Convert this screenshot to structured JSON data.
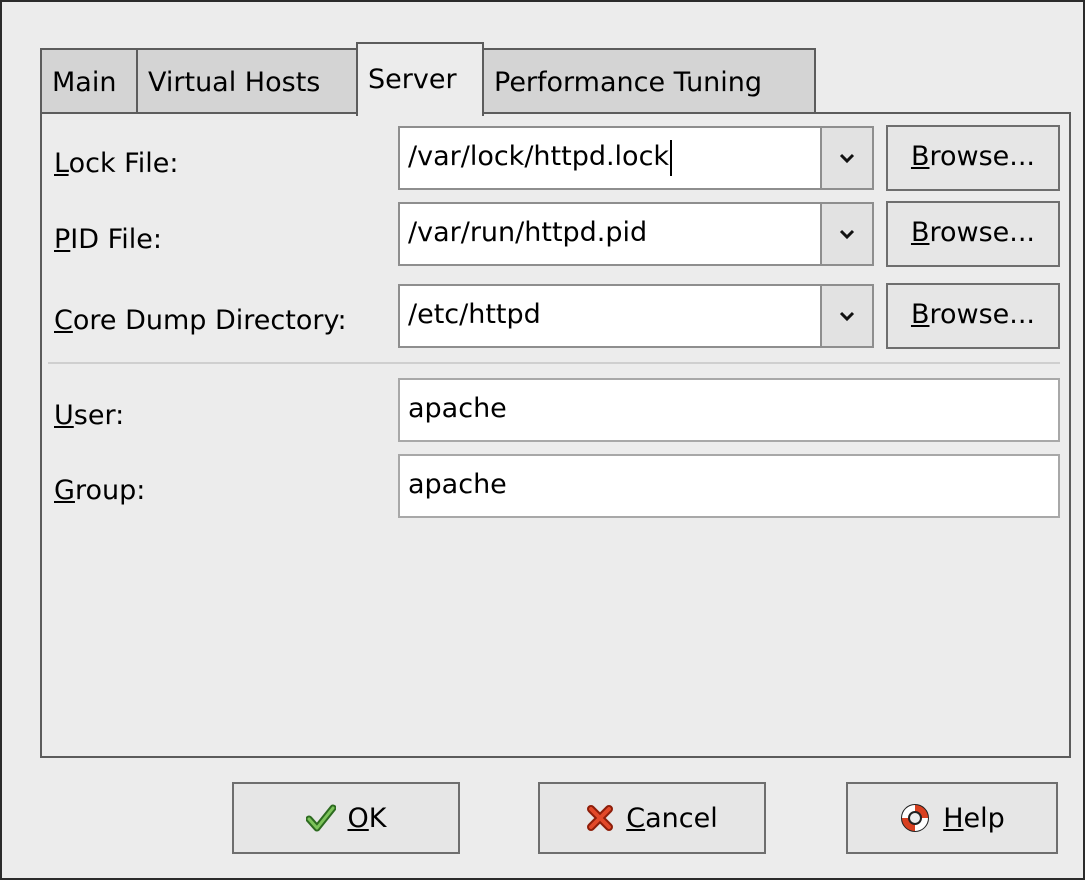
{
  "tabs": [
    {
      "label": "Main",
      "active": false
    },
    {
      "label": "Virtual Hosts",
      "active": false
    },
    {
      "label": "Server",
      "active": true
    },
    {
      "label": "Performance Tuning",
      "active": false
    }
  ],
  "server": {
    "lock_file": {
      "mnemonic": "L",
      "label_rest": "ock File:",
      "value": "/var/lock/httpd.lock"
    },
    "pid_file": {
      "mnemonic": "P",
      "label_rest": "ID File:",
      "value": "/var/run/httpd.pid"
    },
    "core_dump": {
      "mnemonic": "C",
      "label_rest": "ore Dump Directory:",
      "value": "/etc/httpd"
    },
    "browse": {
      "mnemonic": "B",
      "rest": "rowse..."
    },
    "user": {
      "mnemonic": "U",
      "label_rest": "ser:",
      "value": "apache"
    },
    "group": {
      "mnemonic": "G",
      "label_rest": "roup:",
      "value": "apache"
    }
  },
  "buttons": {
    "ok": {
      "mnemonic": "O",
      "rest": "K"
    },
    "cancel": {
      "mnemonic": "C",
      "rest": "ancel"
    },
    "help": {
      "mnemonic": "H",
      "rest": "elp"
    }
  },
  "icons": {
    "ok": "checkmark-icon",
    "cancel": "x-icon",
    "help": "lifebuoy-icon",
    "combo": "chevron-down-icon"
  },
  "colors": {
    "check_green": "#3a8a2a",
    "cancel_red": "#d03a1e",
    "lifebuoy_red": "#d84020"
  }
}
